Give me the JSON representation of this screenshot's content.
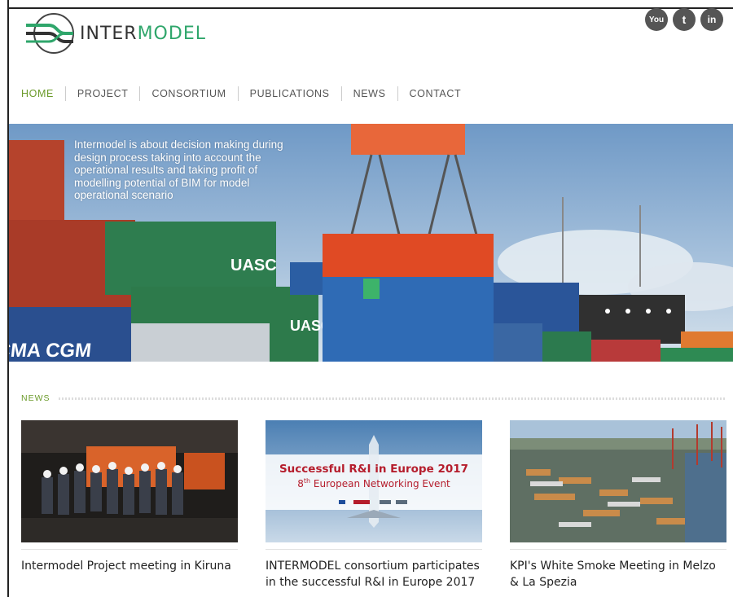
{
  "brand": {
    "name_part1": "INTER",
    "name_part2": "MODEL",
    "accent_color": "#2fa66b"
  },
  "social": [
    {
      "name": "youtube",
      "label": "You"
    },
    {
      "name": "twitter",
      "label": "t"
    },
    {
      "name": "linkedin",
      "label": "in"
    }
  ],
  "nav": {
    "items": [
      "HOME",
      "PROJECT",
      "CONSORTIUM",
      "PUBLICATIONS",
      "NEWS",
      "CONTACT"
    ],
    "active": "HOME",
    "active_color": "#6c9b2b"
  },
  "hero": {
    "caption": "Intermodel is about decision making during design process taking into account the operational results and taking profit of modelling potential of BIM for model operational scenario",
    "container_text_1": "UASC",
    "container_text_2": "UASC",
    "container_text_3": "CMA CGM"
  },
  "news": {
    "label": "NEWS",
    "cards": [
      {
        "title": "Intermodel Project meeting in Kiruna"
      },
      {
        "title": "INTERMODEL consortium participates in the successful R&I in Europe 2017",
        "image_title": "Successful R&I in Europe 2017",
        "image_sub_ordinal": "8",
        "image_sub_suffix": "th",
        "image_sub_rest": " European Networking Event"
      },
      {
        "title": "KPI's White Smoke Meeting in Melzo & La Spezia"
      }
    ]
  }
}
